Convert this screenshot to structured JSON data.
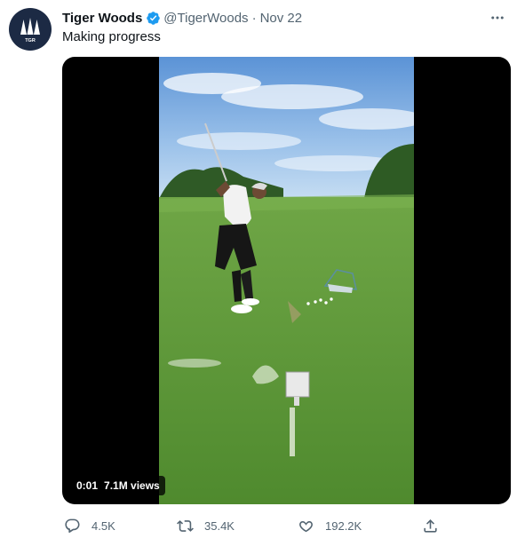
{
  "author": {
    "name": "Tiger Woods",
    "handle": "@TigerWoods",
    "separator": "·",
    "date": "Nov 22",
    "avatar_text": "TGR"
  },
  "tweet": {
    "text": "Making progress"
  },
  "video": {
    "time": "0:01",
    "views": "7.1M views"
  },
  "actions": {
    "reply_count": "4.5K",
    "retweet_count": "35.4K",
    "like_count": "192.2K"
  },
  "colors": {
    "verified": "#1d9bf0",
    "secondary_text": "#536471",
    "avatar_bg": "#1c2a44"
  },
  "icons": [
    "verified-badge-icon",
    "more-options-icon",
    "reply-icon",
    "retweet-icon",
    "like-icon",
    "share-icon"
  ]
}
